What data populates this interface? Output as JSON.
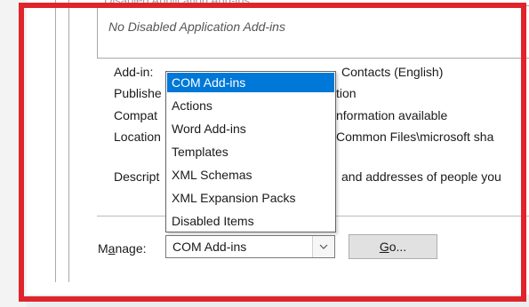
{
  "disabled_section": {
    "clipped_label": "Disabled Application Add-ins",
    "empty_text": "No Disabled Application Add-ins"
  },
  "details": {
    "addin_label": "Add-in:",
    "publisher_label": "Publishe",
    "compat_label": "Compat",
    "location_label": "Location",
    "description_label": "Descript",
    "addin_value": "Contacts (English)",
    "publisher_value": "tion",
    "compat_value": "nformation available",
    "location_value": "Common Files\\microsoft sha",
    "description_value": "and addresses of people you"
  },
  "manage": {
    "label_underlined": "a",
    "label_before": "M",
    "label_after": "nage:",
    "selected": "COM Add-ins",
    "go_underlined": "G",
    "go_rest": "o..."
  },
  "dropdown": {
    "items": [
      "COM Add-ins",
      "Actions",
      "Word Add-ins",
      "Templates",
      "XML Schemas",
      "XML Expansion Packs",
      "Disabled Items"
    ],
    "selected_index": 0
  },
  "colors": {
    "highlight": "#0078d7",
    "annotation_frame": "#e0242c"
  }
}
